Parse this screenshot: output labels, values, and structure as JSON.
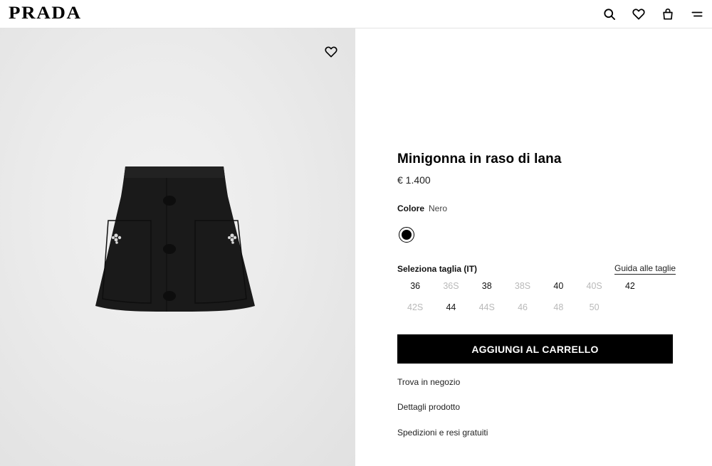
{
  "header": {
    "logo": "PRADA",
    "icons": [
      "search-icon",
      "heart-icon",
      "bag-icon",
      "menu-icon"
    ]
  },
  "product": {
    "name": "Minigonna in raso di lana",
    "price": "€ 1.400",
    "color_label": "Colore",
    "color_value": "Nero",
    "swatch_color": "#000000",
    "size_label": "Seleziona taglia (IT)",
    "size_guide": "Guida alle taglie",
    "sizes": [
      {
        "label": "36",
        "available": true
      },
      {
        "label": "36S",
        "available": false
      },
      {
        "label": "38",
        "available": true
      },
      {
        "label": "38S",
        "available": false
      },
      {
        "label": "40",
        "available": true
      },
      {
        "label": "40S",
        "available": false
      },
      {
        "label": "42",
        "available": true
      },
      {
        "label": "42S",
        "available": false
      },
      {
        "label": "44",
        "available": true
      },
      {
        "label": "44S",
        "available": false
      },
      {
        "label": "46",
        "available": false
      },
      {
        "label": "48",
        "available": false
      },
      {
        "label": "50",
        "available": false
      }
    ],
    "add_to_cart": "AGGIUNGI AL CARRELLO",
    "links": [
      "Trova in negozio",
      "Dettagli prodotto",
      "Spedizioni e resi gratuiti"
    ]
  }
}
